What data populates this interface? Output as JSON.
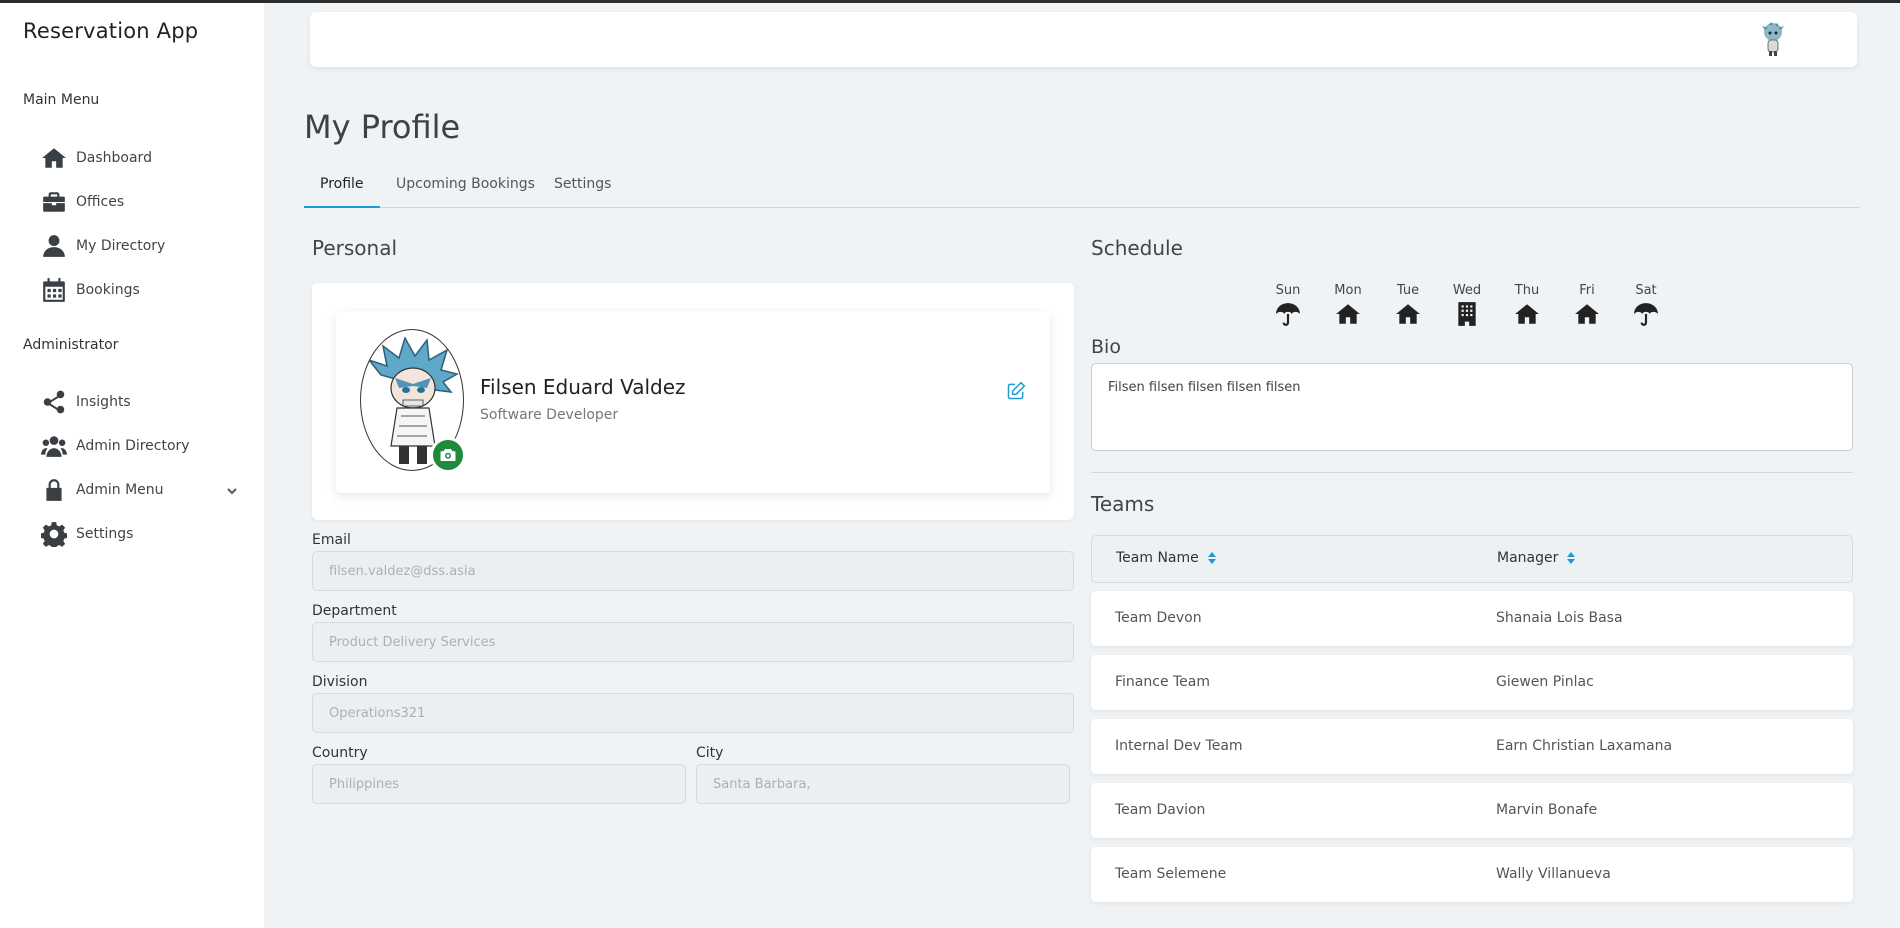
{
  "app": {
    "title": "Reservation App"
  },
  "sidebar": {
    "main_menu_label": "Main Menu",
    "main_items": [
      {
        "label": "Dashboard",
        "icon": "home-icon"
      },
      {
        "label": "Offices",
        "icon": "briefcase-icon"
      },
      {
        "label": "My Directory",
        "icon": "user-icon"
      },
      {
        "label": "Bookings",
        "icon": "calendar-icon"
      }
    ],
    "admin_label": "Administrator",
    "admin_items": [
      {
        "label": "Insights",
        "icon": "share-icon"
      },
      {
        "label": "Admin Directory",
        "icon": "users-icon"
      },
      {
        "label": "Admin Menu",
        "icon": "lock-icon"
      },
      {
        "label": "Settings",
        "icon": "gear-icon"
      }
    ]
  },
  "page": {
    "title": "My Profile"
  },
  "tabs": [
    {
      "label": "Profile",
      "active": true
    },
    {
      "label": "Upcoming Bookings",
      "active": false
    },
    {
      "label": "Settings",
      "active": false
    }
  ],
  "personal": {
    "heading": "Personal",
    "name": "Filsen Eduard Valdez",
    "role": "Software Developer",
    "email_label": "Email",
    "email": "filsen.valdez@dss.asia",
    "department_label": "Department",
    "department": "Product Delivery Services",
    "division_label": "Division",
    "division": "Operations321",
    "country_label": "Country",
    "country": "Philippines",
    "city_label": "City",
    "city": "Santa Barbara,"
  },
  "schedule": {
    "heading": "Schedule",
    "days": [
      {
        "label": "Sun",
        "icon": "umbrella-icon"
      },
      {
        "label": "Mon",
        "icon": "home-icon"
      },
      {
        "label": "Tue",
        "icon": "home-icon"
      },
      {
        "label": "Wed",
        "icon": "building-icon"
      },
      {
        "label": "Thu",
        "icon": "home-icon"
      },
      {
        "label": "Fri",
        "icon": "home-icon"
      },
      {
        "label": "Sat",
        "icon": "umbrella-icon"
      }
    ]
  },
  "bio": {
    "heading": "Bio",
    "text": "Filsen filsen filsen filsen filsen"
  },
  "teams": {
    "heading": "Teams",
    "columns": [
      "Team Name",
      "Manager"
    ],
    "rows": [
      [
        "Team Devon",
        "Shanaia Lois Basa"
      ],
      [
        "Finance Team",
        "Giewen Pinlac"
      ],
      [
        "Internal Dev Team",
        "Earn Christian Laxamana"
      ],
      [
        "Team Davion",
        "Marvin Bonafe"
      ],
      [
        "Team Selemene",
        "Wally Villanueva"
      ]
    ]
  },
  "colors": {
    "accent": "#1e9bd7",
    "camera_button": "#1f8a3c"
  }
}
